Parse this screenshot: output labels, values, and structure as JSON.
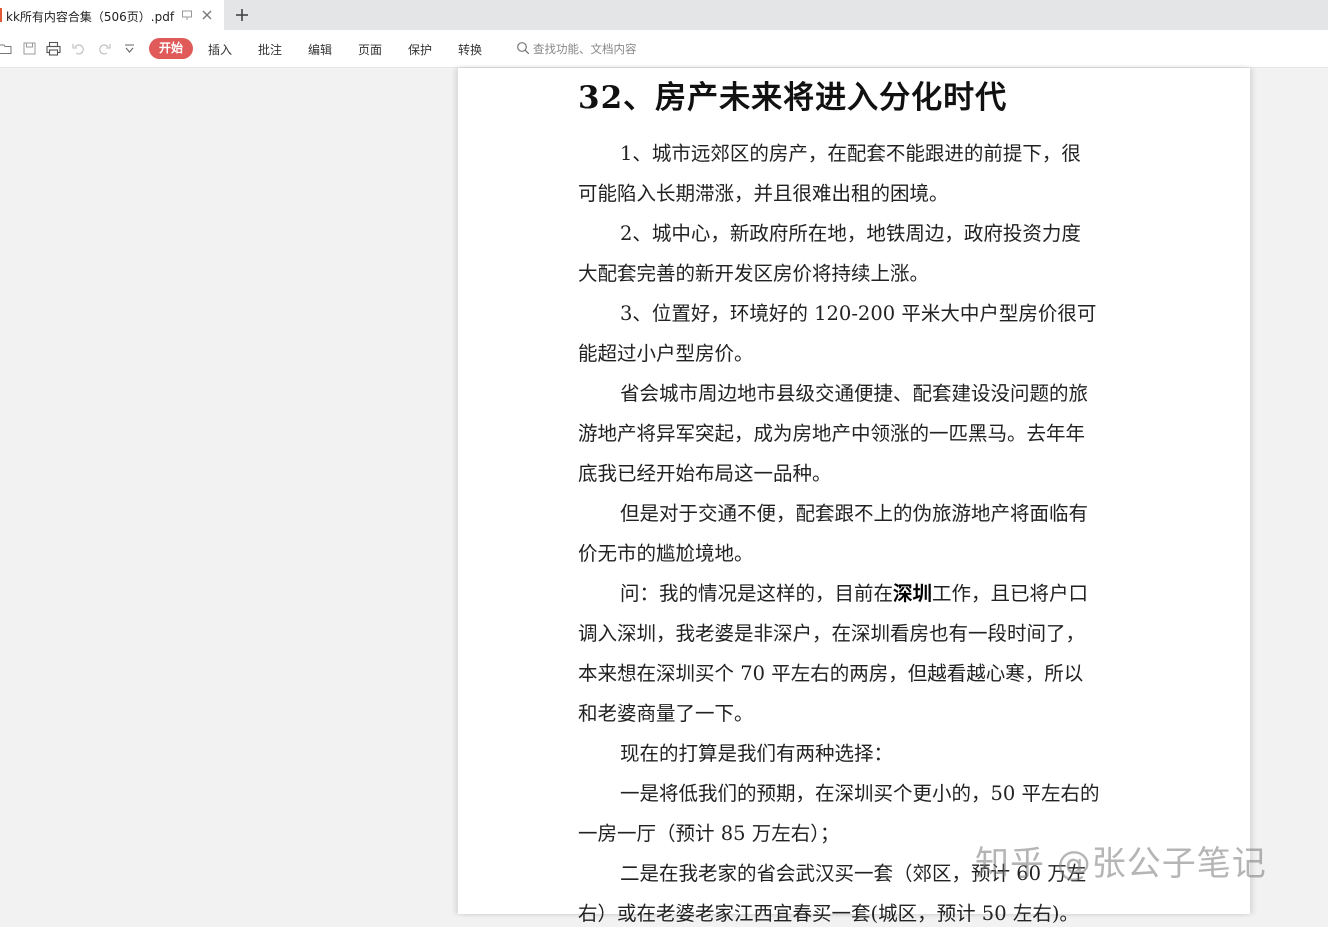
{
  "tab": {
    "title": "kk所有内容合集（506页）.pdf"
  },
  "toolbar": {
    "menus": [
      "开始",
      "插入",
      "批注",
      "编辑",
      "页面",
      "保护",
      "转换"
    ],
    "search_placeholder": "查找功能、文档内容"
  },
  "document": {
    "title": "32、房产未来将进入分化时代",
    "lines": [
      {
        "text": "1、城市远郊区的房产，在配套不能跟进的前提下，很",
        "indent": true
      },
      {
        "text": "可能陷入长期滞涨，并且很难出租的困境。",
        "indent": false
      },
      {
        "text": "2、城中心，新政府所在地，地铁周边，政府投资力度",
        "indent": true
      },
      {
        "text": "大配套完善的新开发区房价将持续上涨。",
        "indent": false
      },
      {
        "text": "3、位置好，环境好的 120-200 平米大中户型房价很可",
        "indent": true
      },
      {
        "text": "能超过小户型房价。",
        "indent": false
      },
      {
        "text": "省会城市周边地市县级交通便捷、配套建设没问题的旅",
        "indent": true
      },
      {
        "text": "游地产将异军突起，成为房地产中领涨的一匹黑马。去年年",
        "indent": false
      },
      {
        "text": "底我已经开始布局这一品种。",
        "indent": false
      },
      {
        "text": "但是对于交通不便，配套跟不上的伪旅游地产将面临有",
        "indent": true
      },
      {
        "text": "价无市的尴尬境地。",
        "indent": false
      },
      {
        "text": "问：我的情况是这样的，目前在",
        "bold": "深圳",
        "after": "工作，且已将户口",
        "indent": true
      },
      {
        "text": "调入深圳，我老婆是非深户，在深圳看房也有一段时间了，",
        "indent": false
      },
      {
        "text": "本来想在深圳买个 70 平左右的两房，但越看越心寒，所以",
        "indent": false
      },
      {
        "text": "和老婆商量了一下。",
        "indent": false
      },
      {
        "text": "现在的打算是我们有两种选择：",
        "indent": true
      },
      {
        "text": "一是将低我们的预期，在深圳买个更小的，50 平左右的",
        "indent": true
      },
      {
        "text": "一房一厅（预计 85 万左右）；",
        "indent": false
      },
      {
        "text": "二是在我老家的省会武汉买一套（郊区，预计 60 万左",
        "indent": true
      },
      {
        "text": "右）或在老婆老家江西宜春买一套(城区，预计 50 左右)。",
        "indent": false
      }
    ]
  },
  "watermark": "知乎 @张公子笔记"
}
